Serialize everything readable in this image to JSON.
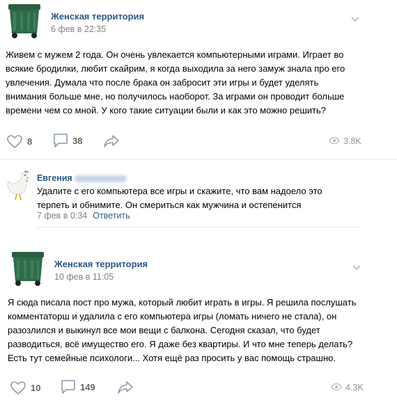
{
  "post1": {
    "author": "Женская территория",
    "date": "6 фев в 22:35",
    "text_lines": [
      "Живем с мужем 2 года. Он очень увлекается компьютерными играми. Играет во",
      "всякие бродилки, любит скайрим, я когда выходила за него замуж знала про его",
      "увлечения. Думала что после брака он забросит эти игры и будет уделять",
      "внимания больше мне, но получилось наоборот. За играми он проводит больше",
      "времени чем со мной. У кого такие ситуации были и как это можно решить?"
    ],
    "likes": "8",
    "comments": "38",
    "views": "3.8K"
  },
  "comment": {
    "author": "Евгения",
    "text_lines": [
      "Удалите с его компьютера все игры и скажите, что вам надоело это",
      "терпеть и обнимите. Он смериться как мужчина и остепенится"
    ],
    "date": "7 фев в 0:34",
    "reply_label": "Ответить"
  },
  "post2": {
    "author": "Женская территория",
    "date": "10 фев в 11:05",
    "text_lines": [
      "Я сюда писала пост про мужа, который любит играть в игры. Я решила послушать",
      "комментаторш и удалила с его компьютера игры (ломать ничего не стала), он",
      "разозлился и выкинул все мои вещи с балкона. Сегодня сказал, что будет",
      "разводиться, всё имущество его. Я даже без квартиры. И что мне теперь делать?",
      "Есть тут семейные психологи... Хотя ещё раз просить у вас помощь страшно."
    ],
    "likes": "10",
    "comments": "149",
    "views": "4.3K"
  },
  "icons": {
    "avatar_group": "green-trash-bin-icon",
    "avatar_commenter": "white-chicken-icon",
    "like": "heart-icon",
    "comment": "speech-bubble-icon",
    "share": "share-arrow-icon",
    "views": "eye-icon",
    "menu": "chevron-down-icon"
  },
  "colors": {
    "link": "#2a5885",
    "muted": "#828282",
    "bin_green": "#2f6b4a"
  }
}
